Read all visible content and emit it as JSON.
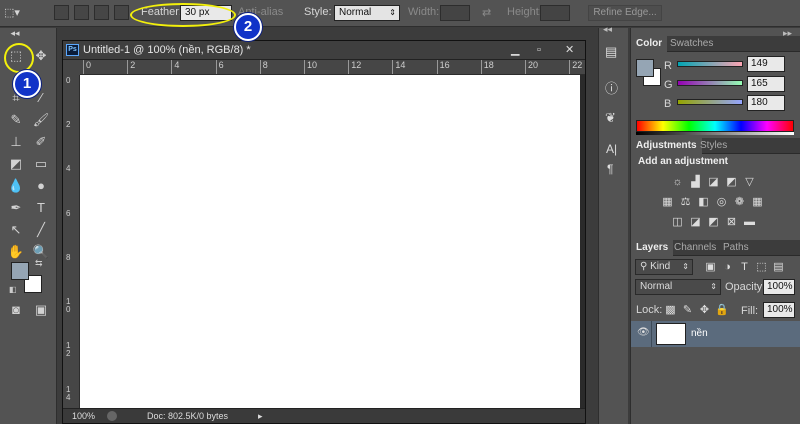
{
  "options_bar": {
    "feather_label": "Feather:",
    "feather_value": "30 px",
    "anti_alias_label": "Anti-alias",
    "style_label": "Style:",
    "style_value": "Normal",
    "width_label": "Width:",
    "height_label": "Height:",
    "refine_edge_label": "Refine Edge..."
  },
  "document": {
    "title": "Untitled-1 @ 100% (nền, RGB/8) *",
    "ps_badge": "Ps",
    "zoom": "100%",
    "doc_info": "Doc: 802.5K/0 bytes",
    "ruler_h_ticks": [
      "0",
      "2",
      "4",
      "6",
      "8",
      "10",
      "12",
      "14",
      "16",
      "18",
      "20",
      "22"
    ],
    "ruler_v_ticks": [
      "0",
      "2",
      "4",
      "6",
      "8",
      "10",
      "12",
      "14"
    ]
  },
  "color_panel": {
    "tabs": [
      "Color",
      "Swatches"
    ],
    "r_label": "R",
    "g_label": "G",
    "b_label": "B",
    "r_value": "149",
    "g_value": "165",
    "b_value": "180",
    "fg_color": "#95a5b4"
  },
  "adjustments_panel": {
    "tabs": [
      "Adjustments",
      "Styles"
    ],
    "heading": "Add an adjustment"
  },
  "layers_panel": {
    "tabs": [
      "Layers",
      "Channels",
      "Paths"
    ],
    "kind_label": "Kind",
    "blend_mode": "Normal",
    "opacity_label": "Opacity:",
    "opacity_value": "100%",
    "lock_label": "Lock:",
    "fill_label": "Fill:",
    "fill_value": "100%",
    "layer_name": "nền"
  },
  "annotations": {
    "badge_1": "1",
    "badge_2": "2",
    "callout_color": "#f3f00b",
    "badge_color": "#1133c8"
  }
}
